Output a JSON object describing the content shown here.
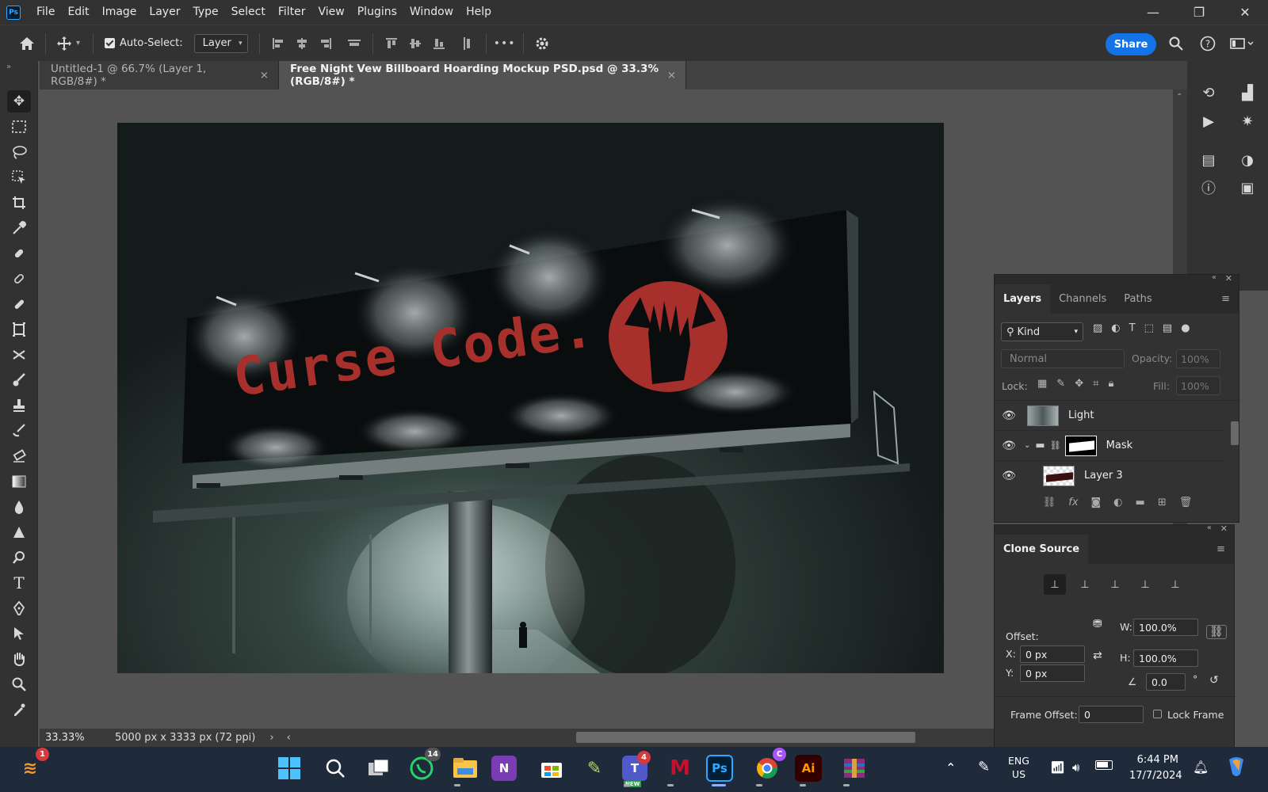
{
  "app": {
    "logo": "Ps"
  },
  "menu": [
    "File",
    "Edit",
    "Image",
    "Layer",
    "Type",
    "Select",
    "Filter",
    "View",
    "Plugins",
    "Window",
    "Help"
  ],
  "window_controls": {
    "minimize": "—",
    "restore": "❐",
    "close": "✕"
  },
  "options": {
    "auto_select_label": "Auto-Select:",
    "auto_select_checked": true,
    "target": "Layer",
    "share": "Share",
    "more": "•••"
  },
  "tabs": [
    {
      "label": "Untitled-1 @ 66.7% (Layer 1, RGB/8#) *",
      "close": "×"
    },
    {
      "label": "Free Night Vew Billboard Hoarding Mockup PSD.psd @ 33.3% (RGB/8#) *",
      "close": "×"
    }
  ],
  "tools": [
    "move",
    "marquee",
    "lasso",
    "object-select",
    "crop",
    "eyedropper",
    "spot-healing",
    "healing-brush",
    "patch",
    "frame",
    "content-aware-move",
    "brush",
    "clone-stamp",
    "history-brush",
    "eraser",
    "gradient",
    "blur",
    "sharpen",
    "dodge",
    "type",
    "pen",
    "path-select",
    "hand",
    "zoom",
    "edit-toolbar"
  ],
  "canvas": {
    "headline": "Curse Code."
  },
  "status": {
    "zoom": "33.33%",
    "doc_size": "5000 px x 3333 px (72 ppi)",
    "arrow": "›",
    "scroll_left": "‹"
  },
  "layers_panel": {
    "tabs": [
      "Layers",
      "Channels",
      "Paths"
    ],
    "filter_kind": "Kind",
    "blend_mode": "Normal",
    "opacity_label": "Opacity:",
    "opacity": "100%",
    "lock_label": "Lock:",
    "fill_label": "Fill:",
    "fill": "100%",
    "layers": [
      {
        "name": "Light",
        "visible": true
      },
      {
        "name": "Mask",
        "visible": true,
        "group": true
      },
      {
        "name": "Layer 3",
        "visible": true
      }
    ]
  },
  "clone_source": {
    "title": "Clone Source",
    "offset_label": "Offset:",
    "x_label": "X:",
    "x": "0 px",
    "y_label": "Y:",
    "y": "0 px",
    "w_label": "W:",
    "w": "100.0%",
    "h_label": "H:",
    "h": "100.0%",
    "angle": "0.0",
    "degree": "°",
    "frame_offset_label": "Frame Offset:",
    "frame_offset": "0",
    "lock_frame_label": "Lock Frame"
  },
  "taskbar": {
    "whatsapp_badge": "14",
    "teams_badge": "4",
    "teams_new": "NEW",
    "chrome_badge": "C",
    "app1_badge": "1",
    "lang": "ENG",
    "region": "US",
    "time": "6:44 PM",
    "date": "17/7/2024"
  },
  "colors": {
    "accent": "#1473e6",
    "billboard_text": "#a8302c",
    "panel": "#323232",
    "canvas_bg": "#535353"
  }
}
